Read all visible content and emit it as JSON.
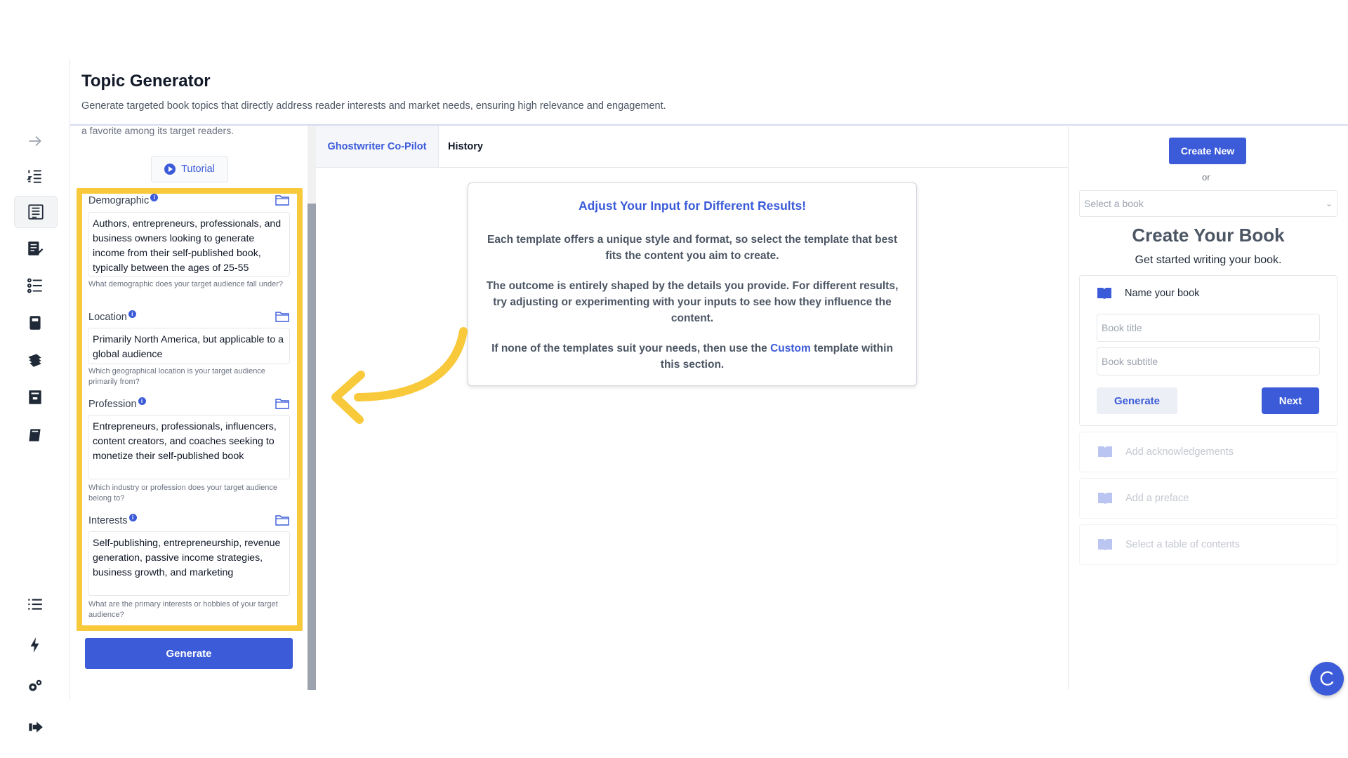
{
  "header": {
    "title": "Topic Generator",
    "subtitle": "Generate targeted book topics that directly address reader interests and market needs, ensuring high relevance and engagement."
  },
  "sidebar": {
    "items": [
      {
        "icon": "arrow-right-icon"
      },
      {
        "icon": "numbered-list-icon"
      },
      {
        "icon": "document-list-icon",
        "active": true
      },
      {
        "icon": "edit-document-icon"
      },
      {
        "icon": "list-icon"
      },
      {
        "icon": "notebook-icon"
      },
      {
        "icon": "books-icon"
      },
      {
        "icon": "archive-icon"
      },
      {
        "icon": "book-icon"
      },
      {
        "icon": "menu-list-icon"
      },
      {
        "icon": "lightning-icon"
      },
      {
        "icon": "settings-icon"
      },
      {
        "icon": "logout-icon"
      }
    ]
  },
  "form": {
    "cut_text": "a favorite among its target readers.",
    "tutorial_label": "Tutorial",
    "info_glyph": "i",
    "fields": [
      {
        "label": "Demographic",
        "value": "Authors, entrepreneurs, professionals, and business owners looking to generate income from their self-published book, typically between the ages of 25-55",
        "help": "What demographic does your target audience fall under?"
      },
      {
        "label": "Location",
        "value": "Primarily North America, but applicable to a global audience",
        "help": "Which geographical location is your target audience primarily from?"
      },
      {
        "label": "Profession",
        "value": "Entrepreneurs, professionals, influencers, content creators, and coaches seeking to monetize their self-published book",
        "help": "Which industry or profession does your target audience belong to?"
      },
      {
        "label": "Interests",
        "value": "Self-publishing, entrepreneurship, revenue generation, passive income strategies, business growth, and marketing",
        "help": "What are the primary interests or hobbies of your target audience?"
      }
    ],
    "generate_label": "Generate"
  },
  "tabs": [
    {
      "label": "Ghostwriter Co-Pilot",
      "active": true
    },
    {
      "label": "History"
    }
  ],
  "info_card": {
    "title": "Adjust Your Input for Different Results!",
    "p1": "Each template offers a unique style and format, so select the template that best fits the content you aim to create.",
    "p2": "The outcome is entirely shaped by the details you provide. For different results, try adjusting or experimenting with your inputs to see how they influence the content.",
    "p3_pre": "If none of the templates suit your needs, then use the ",
    "p3_link": "Custom",
    "p3_post": " template within this section."
  },
  "right": {
    "create_new_label": "Create New",
    "or_text": "or",
    "select_placeholder": "Select a book",
    "select_chevron": "⌄",
    "title": "Create Your Book",
    "subtitle": "Get started writing your book.",
    "name_label": "Name your book",
    "book_title_placeholder": "Book title",
    "book_subtitle_placeholder": "Book subtitle",
    "generate_label": "Generate",
    "next_label": "Next",
    "steps": [
      "Add acknowledgements",
      "Add a preface",
      "Select a table of contents"
    ]
  },
  "colors": {
    "accent": "#3b5bd9",
    "highlight": "#f8c93a"
  }
}
